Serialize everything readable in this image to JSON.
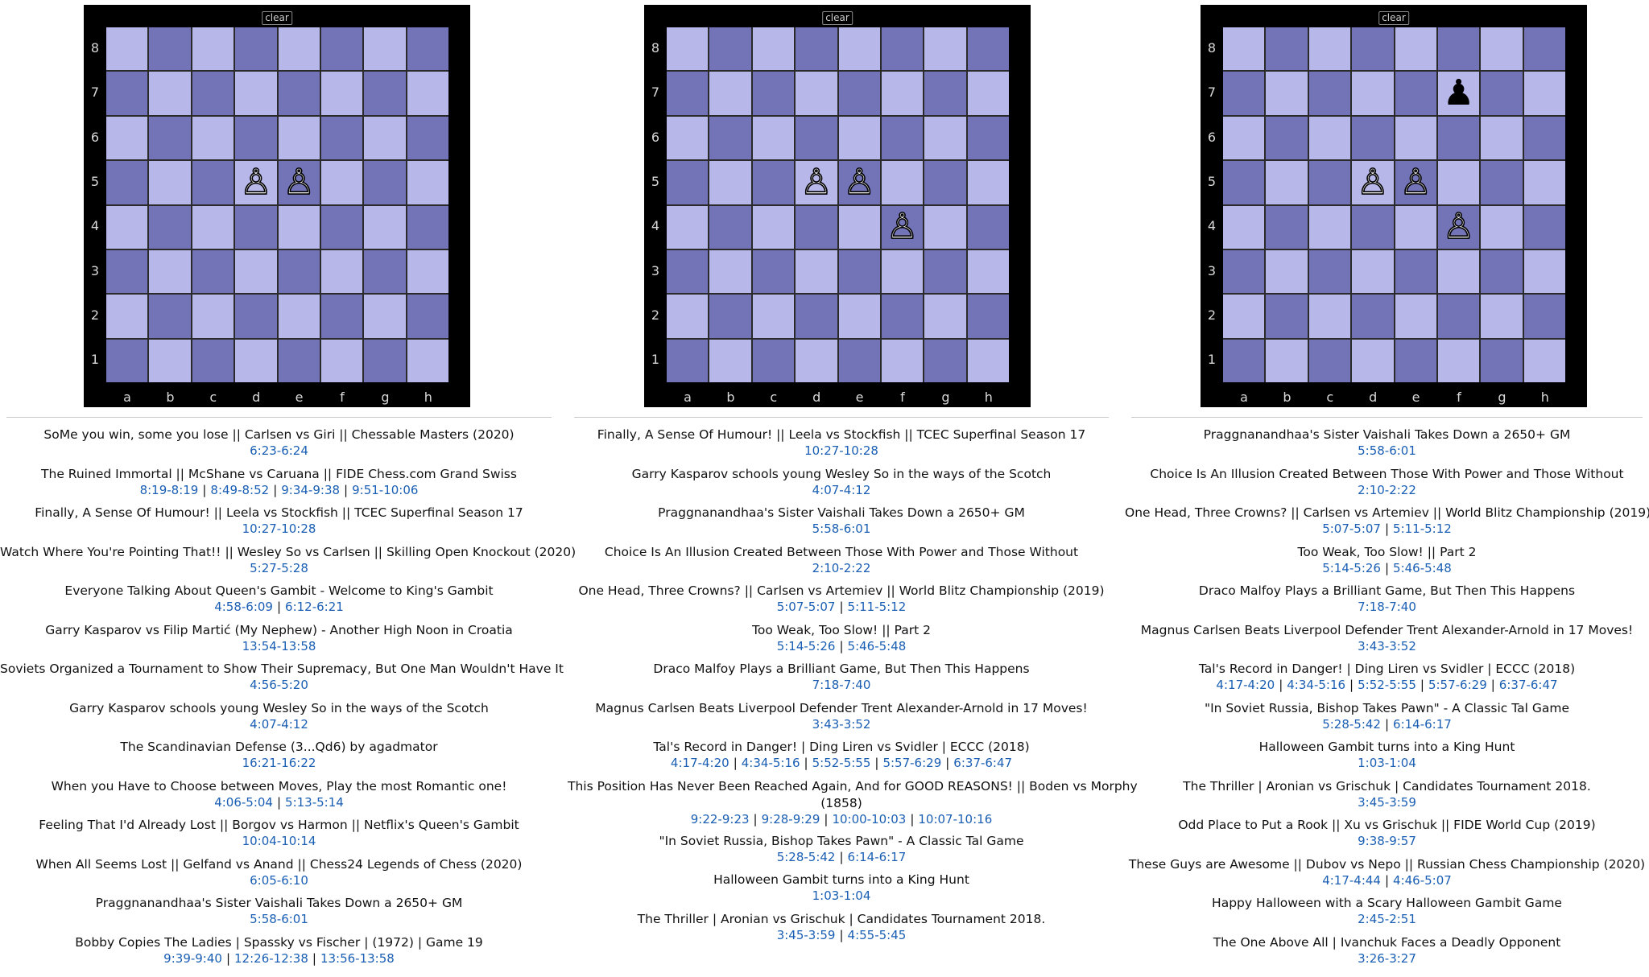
{
  "boards": [
    {
      "clear_label": "clear",
      "ranks": [
        "8",
        "7",
        "6",
        "5",
        "4",
        "3",
        "2",
        "1"
      ],
      "files": [
        "a",
        "b",
        "c",
        "d",
        "e",
        "f",
        "g",
        "h"
      ],
      "pieces": [
        {
          "square": "d5",
          "glyph": "♙",
          "color": "white",
          "name": "white-pawn"
        },
        {
          "square": "e5",
          "glyph": "♙",
          "color": "white",
          "name": "white-pawn"
        }
      ],
      "games": [
        {
          "title": "SoMe you win, some you lose || Carlsen vs Giri || Chessable Masters (2020)",
          "links": [
            "6:23-6:24"
          ]
        },
        {
          "title": "The Ruined Immortal || McShane vs Caruana || FIDE Chess.com Grand Swiss",
          "links": [
            "8:19-8:19",
            "8:49-8:52",
            "9:34-9:38",
            "9:51-10:06"
          ]
        },
        {
          "title": "Finally, A Sense Of Humour! || Leela vs Stockfish || TCEC Superfinal Season 17",
          "links": [
            "10:27-10:28"
          ]
        },
        {
          "title": "Watch Where You're Pointing That!! || Wesley So vs Carlsen || Skilling Open Knockout (2020)",
          "links": [
            "5:27-5:28"
          ]
        },
        {
          "title": "Everyone Talking About Queen's Gambit - Welcome to King's Gambit",
          "links": [
            "4:58-6:09",
            "6:12-6:21"
          ]
        },
        {
          "title": "Garry Kasparov vs Filip Martić (My Nephew) - Another High Noon in Croatia",
          "links": [
            "13:54-13:58"
          ]
        },
        {
          "title": "Soviets Organized a Tournament to Show Their Supremacy, But One Man Wouldn't Have It",
          "links": [
            "4:56-5:20"
          ]
        },
        {
          "title": "Garry Kasparov schools young Wesley So in the ways of the Scotch",
          "links": [
            "4:07-4:12"
          ]
        },
        {
          "title": "The Scandinavian Defense (3...Qd6) by agadmator",
          "links": [
            "16:21-16:22"
          ]
        },
        {
          "title": "When you Have to Choose between Moves, Play the most Romantic one!",
          "links": [
            "4:06-5:04",
            "5:13-5:14"
          ]
        },
        {
          "title": "Feeling That I'd Already Lost || Borgov vs Harmon || Netflix's Queen's Gambit",
          "links": [
            "10:04-10:14"
          ]
        },
        {
          "title": "When All Seems Lost || Gelfand vs Anand || Chess24 Legends of Chess (2020)",
          "links": [
            "6:05-6:10"
          ]
        },
        {
          "title": "Praggnanandhaa's Sister Vaishali Takes Down a 2650+ GM",
          "links": [
            "5:58-6:01"
          ]
        },
        {
          "title": "Bobby Copies The Ladies | Spassky vs Fischer | (1972) | Game 19",
          "links": [
            "9:39-9:40",
            "12:26-12:38",
            "13:56-13:58"
          ]
        }
      ]
    },
    {
      "clear_label": "clear",
      "ranks": [
        "8",
        "7",
        "6",
        "5",
        "4",
        "3",
        "2",
        "1"
      ],
      "files": [
        "a",
        "b",
        "c",
        "d",
        "e",
        "f",
        "g",
        "h"
      ],
      "pieces": [
        {
          "square": "d5",
          "glyph": "♙",
          "color": "white",
          "name": "white-pawn"
        },
        {
          "square": "e5",
          "glyph": "♙",
          "color": "white",
          "name": "white-pawn"
        },
        {
          "square": "f4",
          "glyph": "♙",
          "color": "white",
          "name": "white-pawn"
        }
      ],
      "games": [
        {
          "title": "Finally, A Sense Of Humour! || Leela vs Stockfish || TCEC Superfinal Season 17",
          "links": [
            "10:27-10:28"
          ]
        },
        {
          "title": "Garry Kasparov schools young Wesley So in the ways of the Scotch",
          "links": [
            "4:07-4:12"
          ]
        },
        {
          "title": "Praggnanandhaa's Sister Vaishali Takes Down a 2650+ GM",
          "links": [
            "5:58-6:01"
          ]
        },
        {
          "title": "Choice Is An Illusion Created Between Those With Power and Those Without",
          "links": [
            "2:10-2:22"
          ]
        },
        {
          "title": "One Head, Three Crowns? || Carlsen vs Artemiev || World Blitz Championship (2019)",
          "links": [
            "5:07-5:07",
            "5:11-5:12"
          ]
        },
        {
          "title": "Too Weak, Too Slow! || Part 2",
          "links": [
            "5:14-5:26",
            "5:46-5:48"
          ]
        },
        {
          "title": "Draco Malfoy Plays a Brilliant Game, But Then This Happens",
          "links": [
            "7:18-7:40"
          ]
        },
        {
          "title": "Magnus Carlsen Beats Liverpool Defender Trent Alexander-Arnold in 17 Moves!",
          "links": [
            "3:43-3:52"
          ]
        },
        {
          "title": "Tal's Record in Danger! | Ding Liren vs Svidler | ECCC (2018)",
          "links": [
            "4:17-4:20",
            "4:34-5:16",
            "5:52-5:55",
            "5:57-6:29",
            "6:37-6:47"
          ]
        },
        {
          "title": "This Position Has Never Been Reached Again, And for GOOD REASONS! || Boden vs Morphy",
          "title2": "(1858)",
          "links": [
            "9:22-9:23",
            "9:28-9:29",
            "10:00-10:03",
            "10:07-10:16"
          ]
        },
        {
          "title": "\"In Soviet Russia, Bishop Takes Pawn\" - A Classic Tal Game",
          "links": [
            "5:28-5:42",
            "6:14-6:17"
          ]
        },
        {
          "title": "Halloween Gambit turns into a King Hunt",
          "links": [
            "1:03-1:04"
          ]
        },
        {
          "title": "The Thriller | Aronian vs Grischuk | Candidates Tournament 2018.",
          "links": [
            "3:45-3:59",
            "4:55-5:45"
          ]
        }
      ]
    },
    {
      "clear_label": "clear",
      "ranks": [
        "8",
        "7",
        "6",
        "5",
        "4",
        "3",
        "2",
        "1"
      ],
      "files": [
        "a",
        "b",
        "c",
        "d",
        "e",
        "f",
        "g",
        "h"
      ],
      "pieces": [
        {
          "square": "f7",
          "glyph": "♟",
          "color": "black",
          "name": "black-pawn"
        },
        {
          "square": "d5",
          "glyph": "♙",
          "color": "white",
          "name": "white-pawn"
        },
        {
          "square": "e5",
          "glyph": "♙",
          "color": "white",
          "name": "white-pawn"
        },
        {
          "square": "f4",
          "glyph": "♙",
          "color": "white",
          "name": "white-pawn"
        }
      ],
      "games": [
        {
          "title": "Praggnanandhaa's Sister Vaishali Takes Down a 2650+ GM",
          "links": [
            "5:58-6:01"
          ]
        },
        {
          "title": "Choice Is An Illusion Created Between Those With Power and Those Without",
          "links": [
            "2:10-2:22"
          ]
        },
        {
          "title": "One Head, Three Crowns? || Carlsen vs Artemiev || World Blitz Championship (2019)",
          "links": [
            "5:07-5:07",
            "5:11-5:12"
          ]
        },
        {
          "title": "Too Weak, Too Slow! || Part 2",
          "links": [
            "5:14-5:26",
            "5:46-5:48"
          ]
        },
        {
          "title": "Draco Malfoy Plays a Brilliant Game, But Then This Happens",
          "links": [
            "7:18-7:40"
          ]
        },
        {
          "title": "Magnus Carlsen Beats Liverpool Defender Trent Alexander-Arnold in 17 Moves!",
          "links": [
            "3:43-3:52"
          ]
        },
        {
          "title": "Tal's Record in Danger! | Ding Liren vs Svidler | ECCC (2018)",
          "links": [
            "4:17-4:20",
            "4:34-5:16",
            "5:52-5:55",
            "5:57-6:29",
            "6:37-6:47"
          ]
        },
        {
          "title": "\"In Soviet Russia, Bishop Takes Pawn\" - A Classic Tal Game",
          "links": [
            "5:28-5:42",
            "6:14-6:17"
          ]
        },
        {
          "title": "Halloween Gambit turns into a King Hunt",
          "links": [
            "1:03-1:04"
          ]
        },
        {
          "title": "The Thriller | Aronian vs Grischuk | Candidates Tournament 2018.",
          "links": [
            "3:45-3:59"
          ]
        },
        {
          "title": "Odd Place to Put a Rook || Xu vs Grischuk || FIDE World Cup (2019)",
          "links": [
            "9:38-9:57"
          ]
        },
        {
          "title": "These Guys are Awesome || Dubov vs Nepo || Russian Chess Championship (2020)",
          "links": [
            "4:17-4:44",
            "4:46-5:07"
          ]
        },
        {
          "title": "Happy Halloween with a Scary Halloween Gambit Game",
          "links": [
            "2:45-2:51"
          ]
        },
        {
          "title": "The One Above All | Ivanchuk Faces a Deadly Opponent",
          "links": [
            "3:26-3:27"
          ]
        }
      ]
    }
  ]
}
